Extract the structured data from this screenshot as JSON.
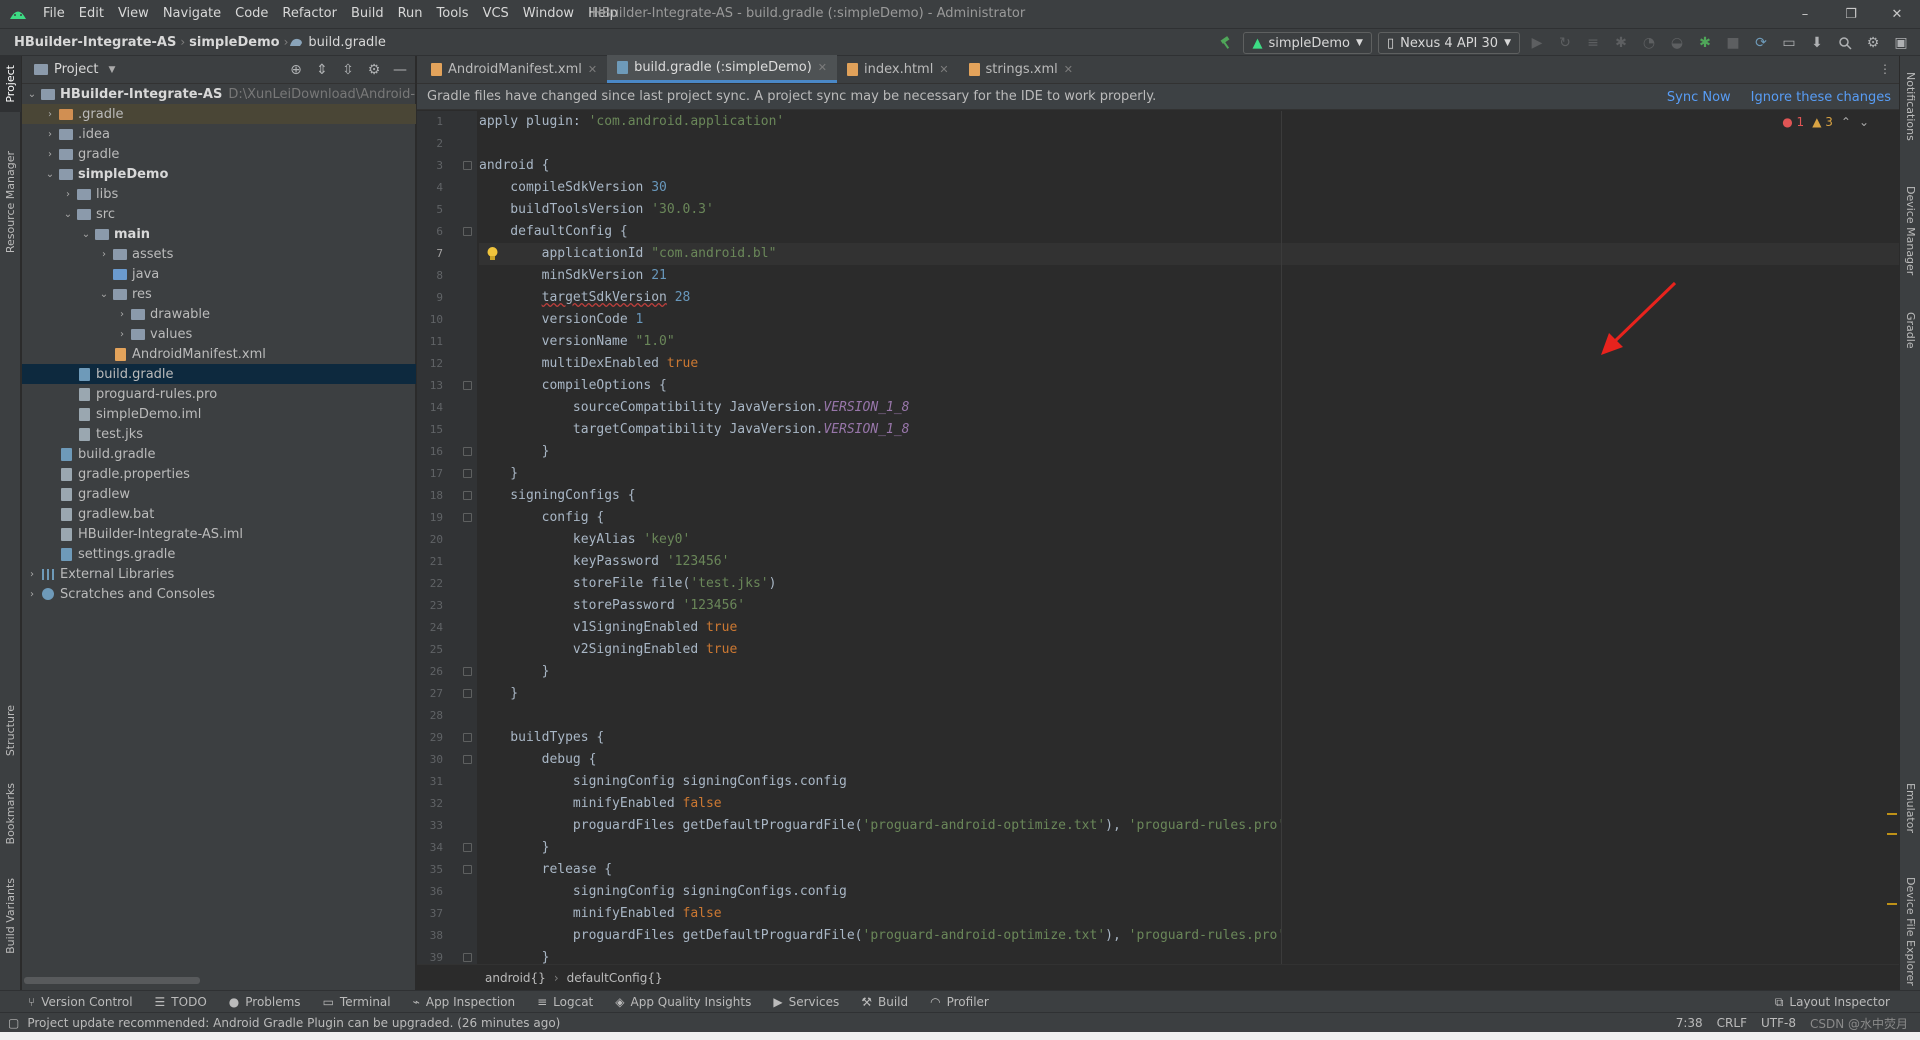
{
  "menubar": {
    "items": [
      "File",
      "Edit",
      "View",
      "Navigate",
      "Code",
      "Refactor",
      "Build",
      "Run",
      "Tools",
      "VCS",
      "Window",
      "Help"
    ],
    "window_title": "HBuilder-Integrate-AS - build.gradle (:simpleDemo) - Administrator",
    "minimize": "–",
    "restore": "❐",
    "close": "✕"
  },
  "navbar": {
    "project": "HBuilder-Integrate-AS",
    "module": "simpleDemo",
    "file": "build.gradle",
    "run_config": "simpleDemo",
    "device": "Nexus 4 API 30"
  },
  "left_strip": {
    "project": "Project",
    "resource_manager": "Resource Manager",
    "structure": "Structure",
    "bookmarks": "Bookmarks",
    "build_variants": "Build Variants"
  },
  "right_strip": {
    "notifications": "Notifications",
    "device_manager": "Device Manager",
    "gradle": "Gradle",
    "emulator": "Emulator",
    "device_file_explorer": "Device File Explorer"
  },
  "project_panel": {
    "title": "Project",
    "root_label": "HBuilder-Integrate-AS",
    "root_path": "D:\\XunLeiDownload\\Android-SDK@",
    "items": [
      {
        "label": ".gradle",
        "icon": "folder-orange",
        "arrow": "›"
      },
      {
        "label": ".idea",
        "icon": "folder",
        "arrow": "›"
      },
      {
        "label": "gradle",
        "icon": "folder",
        "arrow": "›"
      },
      {
        "label": "simpleDemo",
        "icon": "folder-module",
        "arrow": "⌄"
      },
      {
        "label": "libs",
        "icon": "folder",
        "arrow": "›"
      },
      {
        "label": "src",
        "icon": "folder",
        "arrow": "⌄"
      },
      {
        "label": "main",
        "icon": "folder",
        "arrow": "⌄"
      },
      {
        "label": "assets",
        "icon": "folder",
        "arrow": "›"
      },
      {
        "label": "java",
        "icon": "folder-blue",
        "arrow": ""
      },
      {
        "label": "res",
        "icon": "folder",
        "arrow": "⌄"
      },
      {
        "label": "drawable",
        "icon": "folder",
        "arrow": "›"
      },
      {
        "label": "values",
        "icon": "folder",
        "arrow": "›"
      },
      {
        "label": "AndroidManifest.xml",
        "icon": "file-xml",
        "arrow": ""
      },
      {
        "label": "build.gradle",
        "icon": "file-gradle",
        "arrow": ""
      },
      {
        "label": "proguard-rules.pro",
        "icon": "file",
        "arrow": ""
      },
      {
        "label": "simpleDemo.iml",
        "icon": "file",
        "arrow": ""
      },
      {
        "label": "test.jks",
        "icon": "file",
        "arrow": ""
      },
      {
        "label": "build.gradle",
        "icon": "file-gradle",
        "arrow": ""
      },
      {
        "label": "gradle.properties",
        "icon": "file",
        "arrow": ""
      },
      {
        "label": "gradlew",
        "icon": "file",
        "arrow": ""
      },
      {
        "label": "gradlew.bat",
        "icon": "file",
        "arrow": ""
      },
      {
        "label": "HBuilder-Integrate-AS.iml",
        "icon": "file",
        "arrow": ""
      },
      {
        "label": "settings.gradle",
        "icon": "file-gradle",
        "arrow": ""
      },
      {
        "label": "External Libraries",
        "icon": "libraries",
        "arrow": "›"
      },
      {
        "label": "Scratches and Consoles",
        "icon": "scratches",
        "arrow": "›"
      }
    ]
  },
  "tabs": [
    {
      "label": "AndroidManifest.xml"
    },
    {
      "label": "build.gradle (:simpleDemo)"
    },
    {
      "label": "index.html"
    },
    {
      "label": "strings.xml"
    }
  ],
  "notice": {
    "text": "Gradle files have changed since last project sync. A project sync may be necessary for the IDE to work properly.",
    "sync_now": "Sync Now",
    "ignore": "Ignore these changes"
  },
  "inspections": {
    "errors": "1",
    "warnings": "3"
  },
  "code_lines": [
    "apply plugin: 'com.android.application'",
    "",
    "android {",
    "    compileSdkVersion 30",
    "    buildToolsVersion '30.0.3'",
    "    defaultConfig {",
    "        applicationId \"com.android.bl\"",
    "        minSdkVersion 21",
    "        targetSdkVersion 28",
    "        versionCode 1",
    "        versionName \"1.0\"",
    "        multiDexEnabled true",
    "        compileOptions {",
    "            sourceCompatibility JavaVersion.VERSION_1_8",
    "            targetCompatibility JavaVersion.VERSION_1_8",
    "        }",
    "    }",
    "    signingConfigs {",
    "        config {",
    "            keyAlias 'key0'",
    "            keyPassword '123456'",
    "            storeFile file('test.jks')",
    "            storePassword '123456'",
    "            v1SigningEnabled true",
    "            v2SigningEnabled true",
    "        }",
    "    }",
    "",
    "    buildTypes {",
    "        debug {",
    "            signingConfig signingConfigs.config",
    "            minifyEnabled false",
    "            proguardFiles getDefaultProguardFile('proguard-android-optimize.txt'), 'proguard-rules.pro'",
    "        }",
    "        release {",
    "            signingConfig signingConfigs.config",
    "            minifyEnabled false",
    "            proguardFiles getDefaultProguardFile('proguard-android-optimize.txt'), 'proguard-rules.pro'",
    "        }"
  ],
  "current_line": 7,
  "breadcrumb": {
    "a": "android{}",
    "b": "defaultConfig{}"
  },
  "tool_windows": [
    "Version Control",
    "TODO",
    "Problems",
    "Terminal",
    "App Inspection",
    "Logcat",
    "App Quality Insights",
    "Services",
    "Build",
    "Profiler"
  ],
  "layout_inspector": "Layout Inspector",
  "status": {
    "message": "Project update recommended: Android Gradle Plugin can be upgraded. (26 minutes ago)",
    "position": "7:38",
    "line_sep": "CRLF",
    "encoding": "UTF-8",
    "watermark": "CSDN @水中荧月"
  },
  "colors": {
    "keyword": "#cc7832",
    "string": "#6a8759",
    "number": "#6897bb",
    "constant": "#9876aa",
    "link": "#589df6",
    "selection": "#0d293e",
    "annotation_arrow": "#e8231d"
  }
}
